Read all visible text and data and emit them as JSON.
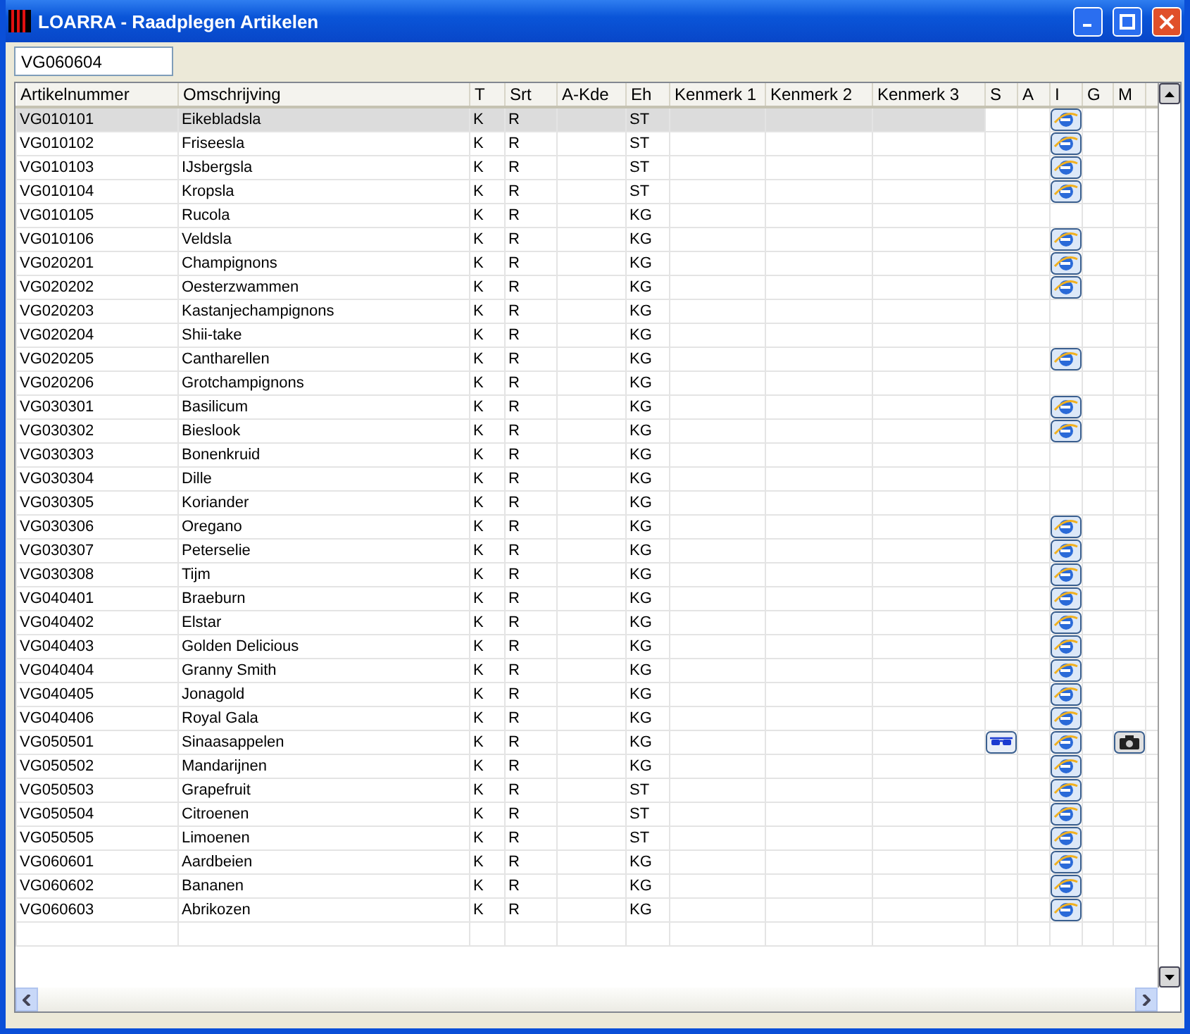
{
  "window": {
    "title": "LOARRA - Raadplegen Artikelen"
  },
  "search": {
    "value": "VG060604"
  },
  "table": {
    "columns": [
      "Artikelnummer",
      "Omschrijving",
      "T",
      "Srt",
      "A-Kde",
      "Eh",
      "Kenmerk 1",
      "Kenmerk 2",
      "Kenmerk 3",
      "S",
      "A",
      "I",
      "G",
      "M"
    ],
    "rows": [
      {
        "nr": "VG010101",
        "name": "Eikebladsla",
        "t": "K",
        "srt": "R",
        "eh": "ST",
        "s": false,
        "i": true,
        "m": false,
        "selected": true
      },
      {
        "nr": "VG010102",
        "name": "Friseesla",
        "t": "K",
        "srt": "R",
        "eh": "ST",
        "s": false,
        "i": true,
        "m": false,
        "selected": false
      },
      {
        "nr": "VG010103",
        "name": "IJsbergsla",
        "t": "K",
        "srt": "R",
        "eh": "ST",
        "s": false,
        "i": true,
        "m": false,
        "selected": false
      },
      {
        "nr": "VG010104",
        "name": "Kropsla",
        "t": "K",
        "srt": "R",
        "eh": "ST",
        "s": false,
        "i": true,
        "m": false,
        "selected": false
      },
      {
        "nr": "VG010105",
        "name": "Rucola",
        "t": "K",
        "srt": "R",
        "eh": "KG",
        "s": false,
        "i": false,
        "m": false,
        "selected": false
      },
      {
        "nr": "VG010106",
        "name": "Veldsla",
        "t": "K",
        "srt": "R",
        "eh": "KG",
        "s": false,
        "i": true,
        "m": false,
        "selected": false
      },
      {
        "nr": "VG020201",
        "name": "Champignons",
        "t": "K",
        "srt": "R",
        "eh": "KG",
        "s": false,
        "i": true,
        "m": false,
        "selected": false
      },
      {
        "nr": "VG020202",
        "name": "Oesterzwammen",
        "t": "K",
        "srt": "R",
        "eh": "KG",
        "s": false,
        "i": true,
        "m": false,
        "selected": false
      },
      {
        "nr": "VG020203",
        "name": "Kastanjechampignons",
        "t": "K",
        "srt": "R",
        "eh": "KG",
        "s": false,
        "i": false,
        "m": false,
        "selected": false
      },
      {
        "nr": "VG020204",
        "name": "Shii-take",
        "t": "K",
        "srt": "R",
        "eh": "KG",
        "s": false,
        "i": false,
        "m": false,
        "selected": false
      },
      {
        "nr": "VG020205",
        "name": "Cantharellen",
        "t": "K",
        "srt": "R",
        "eh": "KG",
        "s": false,
        "i": true,
        "m": false,
        "selected": false
      },
      {
        "nr": "VG020206",
        "name": "Grotchampignons",
        "t": "K",
        "srt": "R",
        "eh": "KG",
        "s": false,
        "i": false,
        "m": false,
        "selected": false
      },
      {
        "nr": "VG030301",
        "name": "Basilicum",
        "t": "K",
        "srt": "R",
        "eh": "KG",
        "s": false,
        "i": true,
        "m": false,
        "selected": false
      },
      {
        "nr": "VG030302",
        "name": "Bieslook",
        "t": "K",
        "srt": "R",
        "eh": "KG",
        "s": false,
        "i": true,
        "m": false,
        "selected": false
      },
      {
        "nr": "VG030303",
        "name": "Bonenkruid",
        "t": "K",
        "srt": "R",
        "eh": "KG",
        "s": false,
        "i": false,
        "m": false,
        "selected": false
      },
      {
        "nr": "VG030304",
        "name": "Dille",
        "t": "K",
        "srt": "R",
        "eh": "KG",
        "s": false,
        "i": false,
        "m": false,
        "selected": false
      },
      {
        "nr": "VG030305",
        "name": "Koriander",
        "t": "K",
        "srt": "R",
        "eh": "KG",
        "s": false,
        "i": false,
        "m": false,
        "selected": false
      },
      {
        "nr": "VG030306",
        "name": "Oregano",
        "t": "K",
        "srt": "R",
        "eh": "KG",
        "s": false,
        "i": true,
        "m": false,
        "selected": false
      },
      {
        "nr": "VG030307",
        "name": "Peterselie",
        "t": "K",
        "srt": "R",
        "eh": "KG",
        "s": false,
        "i": true,
        "m": false,
        "selected": false
      },
      {
        "nr": "VG030308",
        "name": "Tijm",
        "t": "K",
        "srt": "R",
        "eh": "KG",
        "s": false,
        "i": true,
        "m": false,
        "selected": false
      },
      {
        "nr": "VG040401",
        "name": "Braeburn",
        "t": "K",
        "srt": "R",
        "eh": "KG",
        "s": false,
        "i": true,
        "m": false,
        "selected": false
      },
      {
        "nr": "VG040402",
        "name": "Elstar",
        "t": "K",
        "srt": "R",
        "eh": "KG",
        "s": false,
        "i": true,
        "m": false,
        "selected": false
      },
      {
        "nr": "VG040403",
        "name": "Golden Delicious",
        "t": "K",
        "srt": "R",
        "eh": "KG",
        "s": false,
        "i": true,
        "m": false,
        "selected": false
      },
      {
        "nr": "VG040404",
        "name": "Granny Smith",
        "t": "K",
        "srt": "R",
        "eh": "KG",
        "s": false,
        "i": true,
        "m": false,
        "selected": false
      },
      {
        "nr": "VG040405",
        "name": "Jonagold",
        "t": "K",
        "srt": "R",
        "eh": "KG",
        "s": false,
        "i": true,
        "m": false,
        "selected": false
      },
      {
        "nr": "VG040406",
        "name": "Royal Gala",
        "t": "K",
        "srt": "R",
        "eh": "KG",
        "s": false,
        "i": true,
        "m": false,
        "selected": false
      },
      {
        "nr": "VG050501",
        "name": "Sinaasappelen",
        "t": "K",
        "srt": "R",
        "eh": "KG",
        "s": true,
        "i": true,
        "m": true,
        "selected": false
      },
      {
        "nr": "VG050502",
        "name": "Mandarijnen",
        "t": "K",
        "srt": "R",
        "eh": "KG",
        "s": false,
        "i": true,
        "m": false,
        "selected": false
      },
      {
        "nr": "VG050503",
        "name": "Grapefruit",
        "t": "K",
        "srt": "R",
        "eh": "ST",
        "s": false,
        "i": true,
        "m": false,
        "selected": false
      },
      {
        "nr": "VG050504",
        "name": "Citroenen",
        "t": "K",
        "srt": "R",
        "eh": "ST",
        "s": false,
        "i": true,
        "m": false,
        "selected": false
      },
      {
        "nr": "VG050505",
        "name": "Limoenen",
        "t": "K",
        "srt": "R",
        "eh": "ST",
        "s": false,
        "i": true,
        "m": false,
        "selected": false
      },
      {
        "nr": "VG060601",
        "name": "Aardbeien",
        "t": "K",
        "srt": "R",
        "eh": "KG",
        "s": false,
        "i": true,
        "m": false,
        "selected": false
      },
      {
        "nr": "VG060602",
        "name": "Bananen",
        "t": "K",
        "srt": "R",
        "eh": "KG",
        "s": false,
        "i": true,
        "m": false,
        "selected": false
      },
      {
        "nr": "VG060603",
        "name": "Abrikozen",
        "t": "K",
        "srt": "R",
        "eh": "KG",
        "s": false,
        "i": true,
        "m": false,
        "selected": false
      }
    ]
  }
}
